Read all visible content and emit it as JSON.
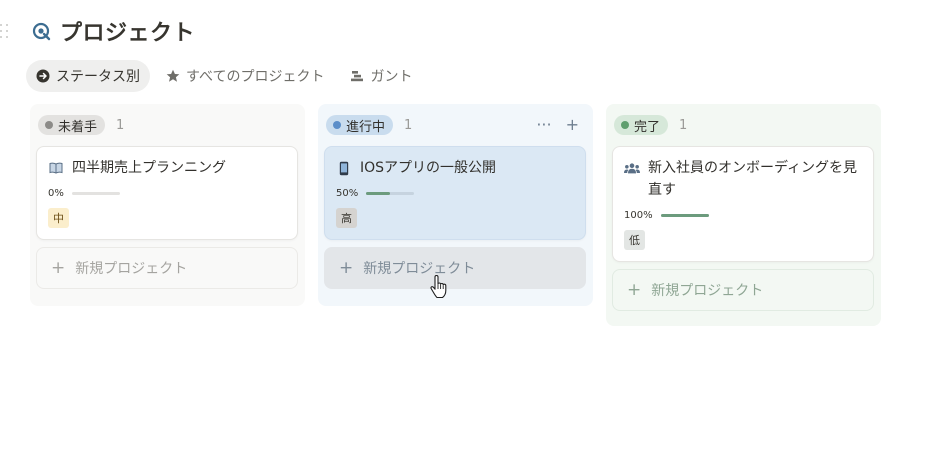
{
  "page": {
    "title": "プロジェクト",
    "title_icon": "project-target-icon"
  },
  "views": [
    {
      "label": "ステータス別",
      "icon": "arrow-circle-icon",
      "active": true
    },
    {
      "label": "すべてのプロジェクト",
      "icon": "star-icon",
      "active": false
    },
    {
      "label": "ガント",
      "icon": "gantt-icon",
      "active": false
    }
  ],
  "columns": [
    {
      "status": "未着手",
      "count": "1",
      "dot_color": "#8c8b88",
      "pill_bg": "#e3e2e0",
      "cards": [
        {
          "icon": "book-icon",
          "title": "四半期売上プランニング",
          "progress_label": "0%",
          "progress": 0,
          "priority": "中",
          "priority_bg": "#fbeecc",
          "priority_fg": "#6b4e16"
        }
      ],
      "new_label": "新規プロジェクト"
    },
    {
      "status": "進行中",
      "count": "1",
      "dot_color": "#5b8ec9",
      "pill_bg": "#c9dcee",
      "actions": {
        "more": "···",
        "add": "+"
      },
      "cards": [
        {
          "icon": "phone-icon",
          "title": "IOSアプリの一般公開",
          "progress_label": "50%",
          "progress": 0.5,
          "priority": "高",
          "priority_bg": "#d5d3d0",
          "priority_fg": "#37352f"
        }
      ],
      "new_label": "新規プロジェクト"
    },
    {
      "status": "完了",
      "count": "1",
      "dot_color": "#5f9e6e",
      "pill_bg": "#d6e8d9",
      "cards": [
        {
          "icon": "people-icon",
          "title": "新入社員のオンボーディングを見直す",
          "progress_label": "100%",
          "progress": 1,
          "priority": "低",
          "priority_bg": "#e3e6e4",
          "priority_fg": "#37352f"
        }
      ],
      "new_label": "新規プロジェクト"
    }
  ]
}
